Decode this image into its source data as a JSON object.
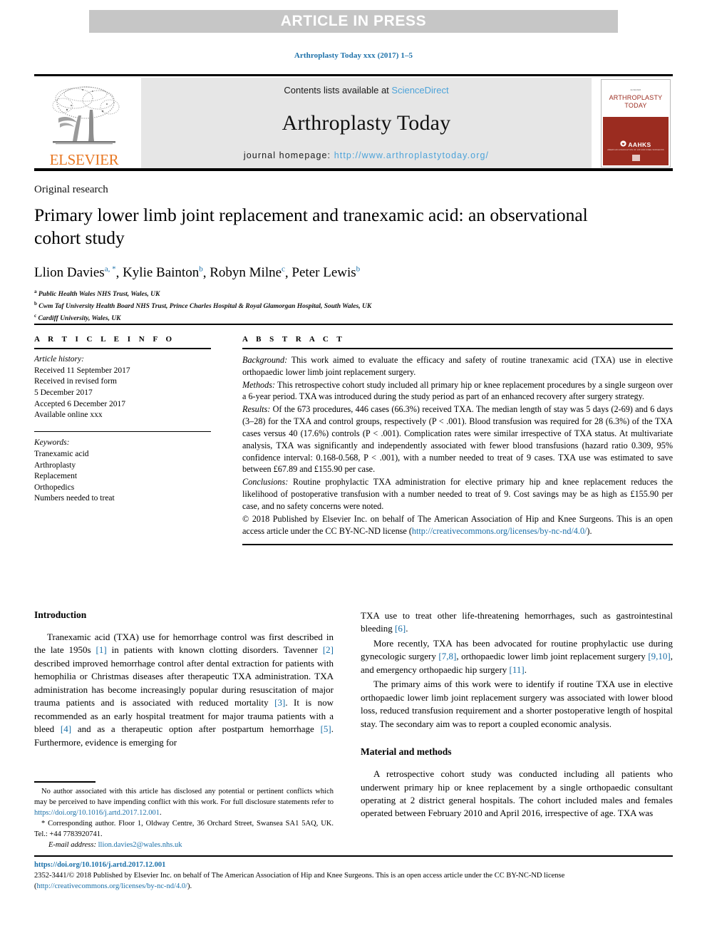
{
  "banner": {
    "text": "ARTICLE IN PRESS"
  },
  "citation": "Arthroplasty Today xxx (2017) 1–5",
  "masthead": {
    "contents_prefix": "Contents lists available at ",
    "contents_link": "ScienceDirect",
    "journal_name": "Arthroplasty Today",
    "homepage_prefix": "journal homepage: ",
    "homepage_url": "http://www.arthroplastytoday.org/",
    "publisher_name": "ELSEVIER",
    "cover": {
      "tiny_top": "ELSEVIER",
      "title_line1": "ARTHROPLASTY",
      "title_line2": "TODAY",
      "society": "AAHKS",
      "society_sub": "AMERICAN ASSOCIATION OF HIP AND KNEE SURGEONS"
    }
  },
  "article": {
    "section_label": "Original research",
    "title": "Primary lower limb joint replacement and tranexamic acid: an observational cohort study",
    "authors": [
      {
        "name": "Llion Davies",
        "marks": "a, *"
      },
      {
        "name": "Kylie Bainton",
        "marks": "b"
      },
      {
        "name": "Robyn Milne",
        "marks": "c"
      },
      {
        "name": "Peter Lewis",
        "marks": "b"
      }
    ],
    "affiliations": [
      {
        "mark": "a",
        "text": "Public Health Wales NHS Trust, Wales, UK"
      },
      {
        "mark": "b",
        "text": "Cwm Taf University Health Board NHS Trust, Prince Charles Hospital & Royal Glamorgan Hospital, South Wales, UK"
      },
      {
        "mark": "c",
        "text": "Cardiff University, Wales, UK"
      }
    ]
  },
  "article_info": {
    "heading": "A R T I C L E   I N F O",
    "history_label": "Article history:",
    "history": [
      "Received 11 September 2017",
      "Received in revised form",
      "5 December 2017",
      "Accepted 6 December 2017",
      "Available online xxx"
    ],
    "keywords_label": "Keywords:",
    "keywords": [
      "Tranexamic acid",
      "Arthroplasty",
      "Replacement",
      "Orthopedics",
      "Numbers needed to treat"
    ]
  },
  "abstract": {
    "heading": "A B S T R A C T",
    "background_label": "Background:",
    "background": " This work aimed to evaluate the efficacy and safety of routine tranexamic acid (TXA) use in elective orthopaedic lower limb joint replacement surgery.",
    "methods_label": "Methods:",
    "methods": " This retrospective cohort study included all primary hip or knee replacement procedures by a single surgeon over a 6-year period. TXA was introduced during the study period as part of an enhanced recovery after surgery strategy.",
    "results_label": "Results:",
    "results": " Of the 673 procedures, 446 cases (66.3%) received TXA. The median length of stay was 5 days (2-69) and 6 days (3–28) for the TXA and control groups, respectively (P < .001). Blood transfusion was required for 28 (6.3%) of the TXA cases versus 40 (17.6%) controls (P < .001). Complication rates were similar irrespective of TXA status. At multivariate analysis, TXA was significantly and independently associated with fewer blood transfusions (hazard ratio 0.309, 95% confidence interval: 0.168-0.568, P < .001), with a number needed to treat of 9 cases. TXA use was estimated to save between £67.89 and £155.90 per case.",
    "conclusions_label": "Conclusions:",
    "conclusions": " Routine prophylactic TXA administration for elective primary hip and knee replacement reduces the likelihood of postoperative transfusion with a number needed to treat of 9. Cost savings may be as high as £155.90 per case, and no safety concerns were noted.",
    "copyright_pre": "© 2018 Published by Elsevier Inc. on behalf of The American Association of Hip and Knee Surgeons. This is an open access article under the CC BY-NC-ND license (",
    "copyright_link": "http://creativecommons.org/licenses/by-nc-nd/4.0/",
    "copyright_post": ")."
  },
  "body": {
    "left": {
      "heading": "Introduction",
      "paragraph1_a": "Tranexamic acid (TXA) use for hemorrhage control was first described in the late 1950s ",
      "ref1": "[1]",
      "paragraph1_b": " in patients with known clotting disorders. Tavenner ",
      "ref2": "[2]",
      "paragraph1_c": " described improved hemorrhage control after dental extraction for patients with hemophilia or Christmas diseases after therapeutic TXA administration. TXA administration has become increasingly popular during resuscitation of major trauma patients and is associated with reduced mortality ",
      "ref3": "[3]",
      "paragraph1_d": ". It is now recommended as an early hospital treatment for major trauma patients with a bleed ",
      "ref4": "[4]",
      "paragraph1_e": " and as a therapeutic option after postpartum hemorrhage ",
      "ref5": "[5]",
      "paragraph1_f": ". Furthermore, evidence is emerging for"
    },
    "right": {
      "paragraph1_cont_a": "TXA use to treat other life-threatening hemorrhages, such as gastrointestinal bleeding ",
      "ref6": "[6]",
      "paragraph1_cont_b": ".",
      "paragraph2_a": "More recently, TXA has been advocated for routine prophylactic use during gynecologic surgery ",
      "ref78": "[7,8]",
      "paragraph2_b": ", orthopaedic lower limb joint replacement surgery ",
      "ref910": "[9,10]",
      "paragraph2_c": ", and emergency orthopaedic hip surgery ",
      "ref11": "[11]",
      "paragraph2_d": ".",
      "paragraph3": "The primary aims of this work were to identify if routine TXA use in elective orthopaedic lower limb joint replacement surgery was associated with lower blood loss, reduced transfusion requirement and a shorter postoperative length of hospital stay. The secondary aim was to report a coupled economic analysis.",
      "heading2": "Material and methods",
      "paragraph4": "A retrospective cohort study was conducted including all patients who underwent primary hip or knee replacement by a single orthopaedic consultant operating at 2 district general hospitals. The cohort included males and females operated between February 2010 and April 2016, irrespective of age. TXA was"
    }
  },
  "footnote": {
    "disclosure_a": "No author associated with this article has disclosed any potential or pertinent conflicts which may be perceived to have impending conflict with this work. For full disclosure statements refer to ",
    "disclosure_link": "https://doi.org/10.1016/j.artd.2017.12.001",
    "disclosure_b": ".",
    "corresponding": "* Corresponding author. Floor 1, Oldway Centre, 36 Orchard Street, Swansea SA1 5AQ, UK. Tel.: +44 7783920741.",
    "email_label": "E-mail address:",
    "email": "llion.davies2@wales.nhs.uk"
  },
  "bottom": {
    "doi": "https://doi.org/10.1016/j.artd.2017.12.001",
    "issn_line_a": "2352-3441/© 2018 Published by Elsevier Inc. on behalf of The American Association of Hip and Knee Surgeons. This is an open access article under the CC BY-NC-ND license",
    "issn_line_b_pre": "(",
    "issn_link": "http://creativecommons.org/licenses/by-nc-nd/4.0/",
    "issn_line_b_post": ")."
  },
  "colors": {
    "link": "#1a6fa8",
    "banner_bg": "#c6c6c6",
    "panel_bg": "#e6e6e6",
    "elsevier_orange": "#e87722",
    "cover_red": "#9b2c20",
    "sciencedirect": "#4da3d9"
  }
}
